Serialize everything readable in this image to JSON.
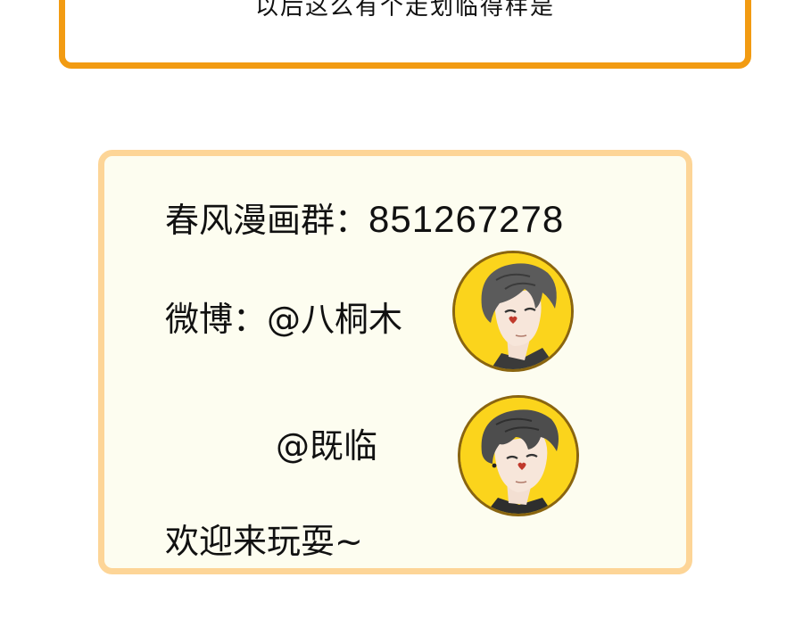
{
  "top_box": {
    "partial_text": "以后这么有个走划临得样是"
  },
  "card": {
    "group_label": "春风漫画群：",
    "group_number": "851267278",
    "weibo_label": "微博：@八桐木",
    "weibo_second": "@既临",
    "welcome": "欢迎来玩耍~"
  },
  "colors": {
    "top_border": "#f29b12",
    "card_border": "#fdd597",
    "card_background": "#fdfdf0",
    "avatar_background": "#fbd41c"
  },
  "avatars": [
    {
      "icon": "character-avatar-icon",
      "description_name": "avatar-bamutong"
    },
    {
      "icon": "character-avatar-icon",
      "description_name": "avatar-jilin"
    }
  ]
}
